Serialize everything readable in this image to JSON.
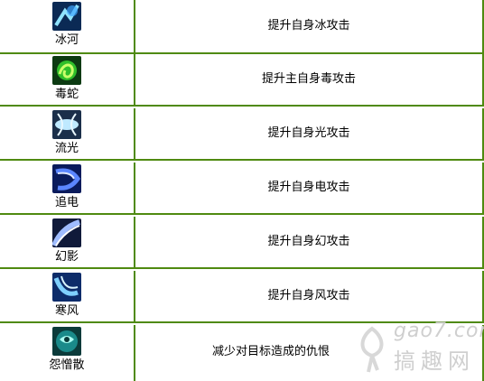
{
  "rows": [
    {
      "name": "冰河",
      "desc": "提升自身冰攻击",
      "icon": "ice-glacier-icon"
    },
    {
      "name": "毒蛇",
      "desc": "提升主自身毒攻击",
      "icon": "poison-snake-icon"
    },
    {
      "name": "流光",
      "desc": "提升自身光攻击",
      "icon": "light-stream-icon"
    },
    {
      "name": "追电",
      "desc": "提升自身电攻击",
      "icon": "lightning-icon"
    },
    {
      "name": "幻影",
      "desc": "提升自身幻攻击",
      "icon": "phantom-icon"
    },
    {
      "name": "寒风",
      "desc": "提升自身风攻击",
      "icon": "cold-wind-icon"
    },
    {
      "name": "怨憎散",
      "desc": "减少对目标造成的仇恨",
      "icon": "resentment-icon"
    }
  ],
  "watermark": {
    "url": "gao7.com",
    "site": "搞趣网"
  },
  "colors": {
    "border": "#4f8a10"
  }
}
